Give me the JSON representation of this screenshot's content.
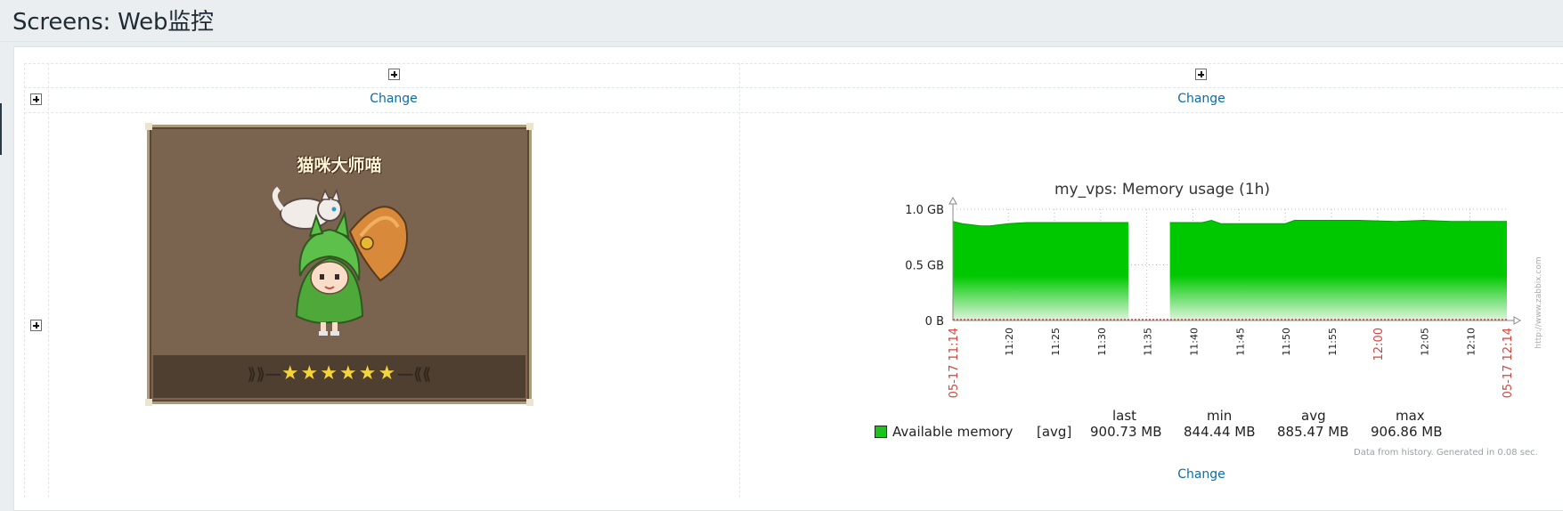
{
  "page": {
    "title": "Screens: Web监控"
  },
  "cells": {
    "change_label": "Change"
  },
  "image_widget": {
    "title": "猫咪大师喵",
    "stars": "★★★★★★",
    "colors": {
      "background": "#7a634f",
      "frame": "#a89c7a",
      "star": "#f5d33a"
    }
  },
  "graph": {
    "title": "my_vps: Memory usage (1h)",
    "legend": {
      "item": "Available memory",
      "function": "[avg]",
      "headers": [
        "last",
        "min",
        "avg",
        "max"
      ],
      "values": [
        "900.73 MB",
        "844.44 MB",
        "885.47 MB",
        "906.86 MB"
      ]
    },
    "footnote": "Data from history. Generated in 0.08 sec.",
    "watermark": "http://www.zabbix.com",
    "colors": {
      "series": "#00c800",
      "axis_red": "#d4433b"
    }
  },
  "chart_data": {
    "type": "area",
    "title": "my_vps: Memory usage (1h)",
    "xlabel": "",
    "ylabel": "",
    "y_ticks": [
      "0 B",
      "0.5 GB",
      "1.0 GB"
    ],
    "ylim": [
      0,
      1.0
    ],
    "x_ticks": [
      "05-17 11:14",
      "11:20",
      "11:25",
      "11:30",
      "11:35",
      "11:40",
      "11:45",
      "11:50",
      "11:55",
      "12:00",
      "12:05",
      "12:10",
      "05-17 12:14"
    ],
    "x_range_minutes": [
      0,
      60
    ],
    "series": [
      {
        "name": "Available memory",
        "unit": "GB",
        "points": [
          [
            0,
            0.89
          ],
          [
            1,
            0.87
          ],
          [
            2,
            0.86
          ],
          [
            3,
            0.85
          ],
          [
            4,
            0.85
          ],
          [
            6,
            0.87
          ],
          [
            8,
            0.88
          ],
          [
            12,
            0.88
          ],
          [
            16,
            0.88
          ],
          [
            19,
            0.88
          ],
          [
            23,
            null
          ],
          [
            23.5,
            0.88
          ],
          [
            27,
            0.88
          ],
          [
            28,
            0.9
          ],
          [
            29,
            0.87
          ],
          [
            33,
            0.87
          ],
          [
            36,
            0.87
          ],
          [
            37,
            0.9
          ],
          [
            39,
            0.9
          ],
          [
            44,
            0.9
          ],
          [
            48,
            0.89
          ],
          [
            51,
            0.9
          ],
          [
            54,
            0.89
          ],
          [
            58,
            0.89
          ],
          [
            60,
            0.89
          ]
        ]
      }
    ],
    "gaps": [
      [
        19,
        23.5
      ]
    ]
  }
}
